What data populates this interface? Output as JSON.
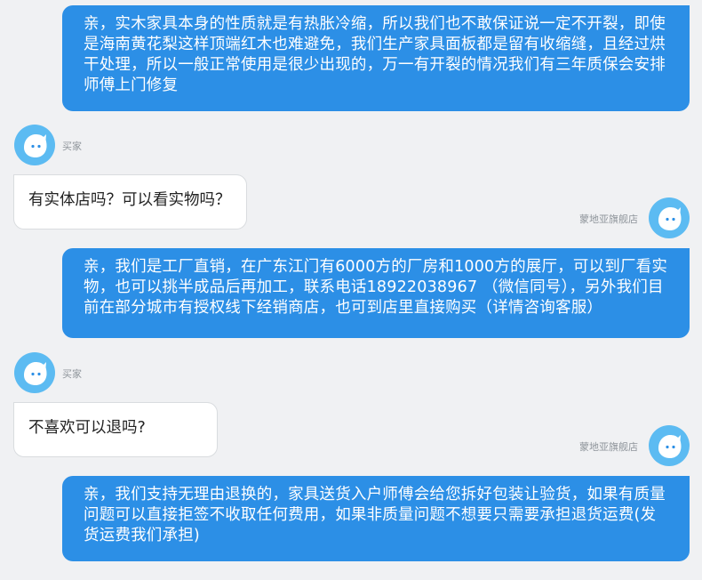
{
  "messages": [
    {
      "role": "seller",
      "text": "亲，实木家具本身的性质就是有热胀冷缩，所以我们也不敢保证说一定不开裂，即使是海南黄花梨这样顶端红木也难避免，我们生产家具面板都是留有收缩缝，且经过烘干处理，所以一般正常使用是很少出现的，万一有开裂的情况我们有三年质保会安排师傅上门修复"
    },
    {
      "role": "buyer",
      "name": "买家",
      "text": "有实体店吗？可以看实物吗？"
    },
    {
      "role": "seller",
      "name": "蒙地亚旗舰店",
      "text": "亲，我们是工厂直销，在广东江门有6000方的厂房和1000方的展厅，可以到厂看实物，也可以挑半成品后再加工，联系电话18922038967 （微信同号），另外我们目前在部分城市有授权线下经销商店，也可到店里直接购买（详情咨询客服）"
    },
    {
      "role": "buyer",
      "name": "买家",
      "text": "不喜欢可以退吗?"
    },
    {
      "role": "seller",
      "name": "蒙地亚旗舰店",
      "text": "亲，我们支持无理由退换的，家具送货入户师傅会给您拆好包装让验货，如果有质量问题可以直接拒签不收取任何费用，如果非质量问题不想要只需要承担退货运费(发货运费我们承担)"
    }
  ],
  "avatar_icon": "chat-mascot-icon",
  "colors": {
    "seller_bubble": "#2c8fe6",
    "buyer_bubble": "#ffffff",
    "avatar": "#5cbbf2",
    "background": "#f0f1f3"
  }
}
